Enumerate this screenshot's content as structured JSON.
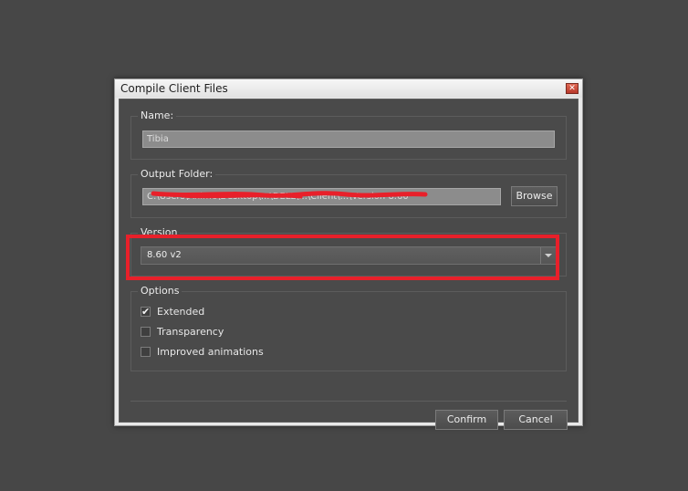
{
  "dialog": {
    "title": "Compile Client Files",
    "close_glyph": "✕"
  },
  "name_group": {
    "legend": "Name:",
    "value": "Tibia"
  },
  "output_group": {
    "legend": "Output Folder:",
    "value": "C:\\Users\\Anime\\Desktop\\...\\DELL\\...\\Client\\...\\Version 8.60",
    "browse_label": "Browse"
  },
  "version_group": {
    "legend": "Version",
    "selected": "8.60 v2",
    "arrow_icon": "chevron-down-icon"
  },
  "options_group": {
    "legend": "Options",
    "items": [
      {
        "label": "Extended",
        "checked": true,
        "mark": "✔"
      },
      {
        "label": "Transparency",
        "checked": false,
        "mark": ""
      },
      {
        "label": "Improved animations",
        "checked": false,
        "mark": ""
      }
    ]
  },
  "footer": {
    "confirm_label": "Confirm",
    "cancel_label": "Cancel"
  },
  "annotations": {
    "highlight_color": "#e8202a",
    "scribble_color": "#e8202a"
  }
}
